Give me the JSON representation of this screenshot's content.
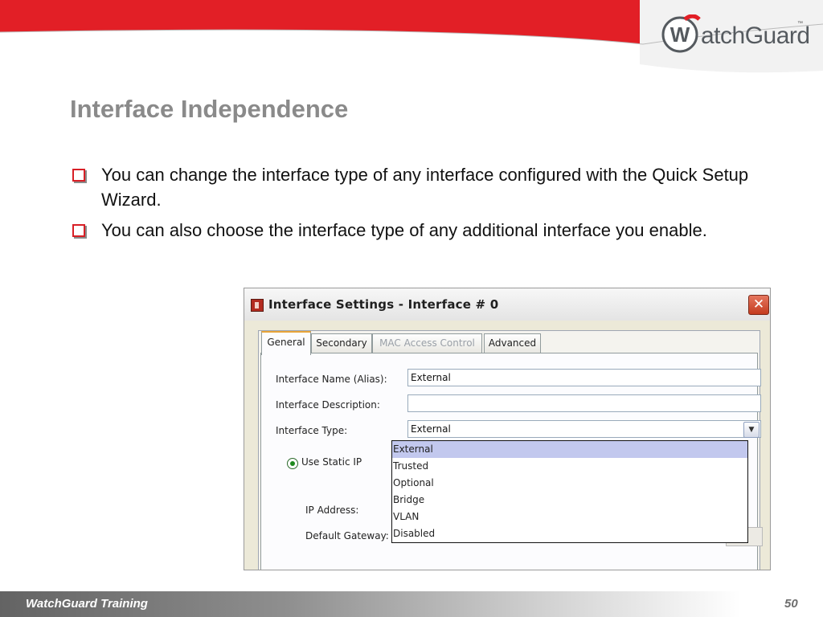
{
  "brand": {
    "logo_letter": "W",
    "logo_text": "atchGuard",
    "logo_tm": "™",
    "color_red": "#e21f26",
    "color_gray": "#555a5f"
  },
  "slide": {
    "title": "Interface Independence",
    "bullets": [
      "You can change the interface type of any interface configured with the Quick Setup Wizard.",
      "You can also choose the interface type of any additional interface you enable."
    ]
  },
  "dialog": {
    "title": "Interface Settings - Interface # 0",
    "close_icon": "✕",
    "tabs": [
      "General",
      "Secondary",
      "MAC Access Control",
      "Advanced"
    ],
    "active_tab": "General",
    "disabled_tab": "MAC Access Control",
    "form": {
      "name_label": "Interface Name (Alias):",
      "name_value": "External",
      "description_label": "Interface Description:",
      "description_value": "",
      "type_label": "Interface Type:",
      "type_value": "External",
      "static_ip_label": "Use Static IP",
      "ip_label": "IP Address:",
      "gateway_label": "Default Gateway:"
    },
    "dropdown_options": [
      "External",
      "Trusted",
      "Optional",
      "Bridge",
      "VLAN",
      "Disabled"
    ],
    "dropdown_selected": "External"
  },
  "footer": {
    "text": "WatchGuard Training",
    "page": "50"
  }
}
